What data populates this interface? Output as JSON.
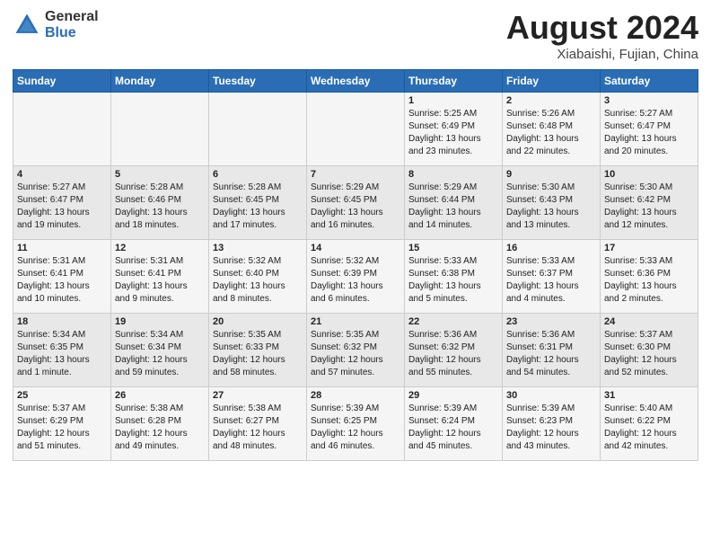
{
  "header": {
    "logo_general": "General",
    "logo_blue": "Blue",
    "title": "August 2024",
    "subtitle": "Xiabaishi, Fujian, China"
  },
  "weekdays": [
    "Sunday",
    "Monday",
    "Tuesday",
    "Wednesday",
    "Thursday",
    "Friday",
    "Saturday"
  ],
  "rows": [
    [
      {
        "day": "",
        "lines": []
      },
      {
        "day": "",
        "lines": []
      },
      {
        "day": "",
        "lines": []
      },
      {
        "day": "",
        "lines": []
      },
      {
        "day": "1",
        "lines": [
          "Sunrise: 5:25 AM",
          "Sunset: 6:49 PM",
          "Daylight: 13 hours",
          "and 23 minutes."
        ]
      },
      {
        "day": "2",
        "lines": [
          "Sunrise: 5:26 AM",
          "Sunset: 6:48 PM",
          "Daylight: 13 hours",
          "and 22 minutes."
        ]
      },
      {
        "day": "3",
        "lines": [
          "Sunrise: 5:27 AM",
          "Sunset: 6:47 PM",
          "Daylight: 13 hours",
          "and 20 minutes."
        ]
      }
    ],
    [
      {
        "day": "4",
        "lines": [
          "Sunrise: 5:27 AM",
          "Sunset: 6:47 PM",
          "Daylight: 13 hours",
          "and 19 minutes."
        ]
      },
      {
        "day": "5",
        "lines": [
          "Sunrise: 5:28 AM",
          "Sunset: 6:46 PM",
          "Daylight: 13 hours",
          "and 18 minutes."
        ]
      },
      {
        "day": "6",
        "lines": [
          "Sunrise: 5:28 AM",
          "Sunset: 6:45 PM",
          "Daylight: 13 hours",
          "and 17 minutes."
        ]
      },
      {
        "day": "7",
        "lines": [
          "Sunrise: 5:29 AM",
          "Sunset: 6:45 PM",
          "Daylight: 13 hours",
          "and 16 minutes."
        ]
      },
      {
        "day": "8",
        "lines": [
          "Sunrise: 5:29 AM",
          "Sunset: 6:44 PM",
          "Daylight: 13 hours",
          "and 14 minutes."
        ]
      },
      {
        "day": "9",
        "lines": [
          "Sunrise: 5:30 AM",
          "Sunset: 6:43 PM",
          "Daylight: 13 hours",
          "and 13 minutes."
        ]
      },
      {
        "day": "10",
        "lines": [
          "Sunrise: 5:30 AM",
          "Sunset: 6:42 PM",
          "Daylight: 13 hours",
          "and 12 minutes."
        ]
      }
    ],
    [
      {
        "day": "11",
        "lines": [
          "Sunrise: 5:31 AM",
          "Sunset: 6:41 PM",
          "Daylight: 13 hours",
          "and 10 minutes."
        ]
      },
      {
        "day": "12",
        "lines": [
          "Sunrise: 5:31 AM",
          "Sunset: 6:41 PM",
          "Daylight: 13 hours",
          "and 9 minutes."
        ]
      },
      {
        "day": "13",
        "lines": [
          "Sunrise: 5:32 AM",
          "Sunset: 6:40 PM",
          "Daylight: 13 hours",
          "and 8 minutes."
        ]
      },
      {
        "day": "14",
        "lines": [
          "Sunrise: 5:32 AM",
          "Sunset: 6:39 PM",
          "Daylight: 13 hours",
          "and 6 minutes."
        ]
      },
      {
        "day": "15",
        "lines": [
          "Sunrise: 5:33 AM",
          "Sunset: 6:38 PM",
          "Daylight: 13 hours",
          "and 5 minutes."
        ]
      },
      {
        "day": "16",
        "lines": [
          "Sunrise: 5:33 AM",
          "Sunset: 6:37 PM",
          "Daylight: 13 hours",
          "and 4 minutes."
        ]
      },
      {
        "day": "17",
        "lines": [
          "Sunrise: 5:33 AM",
          "Sunset: 6:36 PM",
          "Daylight: 13 hours",
          "and 2 minutes."
        ]
      }
    ],
    [
      {
        "day": "18",
        "lines": [
          "Sunrise: 5:34 AM",
          "Sunset: 6:35 PM",
          "Daylight: 13 hours",
          "and 1 minute."
        ]
      },
      {
        "day": "19",
        "lines": [
          "Sunrise: 5:34 AM",
          "Sunset: 6:34 PM",
          "Daylight: 12 hours",
          "and 59 minutes."
        ]
      },
      {
        "day": "20",
        "lines": [
          "Sunrise: 5:35 AM",
          "Sunset: 6:33 PM",
          "Daylight: 12 hours",
          "and 58 minutes."
        ]
      },
      {
        "day": "21",
        "lines": [
          "Sunrise: 5:35 AM",
          "Sunset: 6:32 PM",
          "Daylight: 12 hours",
          "and 57 minutes."
        ]
      },
      {
        "day": "22",
        "lines": [
          "Sunrise: 5:36 AM",
          "Sunset: 6:32 PM",
          "Daylight: 12 hours",
          "and 55 minutes."
        ]
      },
      {
        "day": "23",
        "lines": [
          "Sunrise: 5:36 AM",
          "Sunset: 6:31 PM",
          "Daylight: 12 hours",
          "and 54 minutes."
        ]
      },
      {
        "day": "24",
        "lines": [
          "Sunrise: 5:37 AM",
          "Sunset: 6:30 PM",
          "Daylight: 12 hours",
          "and 52 minutes."
        ]
      }
    ],
    [
      {
        "day": "25",
        "lines": [
          "Sunrise: 5:37 AM",
          "Sunset: 6:29 PM",
          "Daylight: 12 hours",
          "and 51 minutes."
        ]
      },
      {
        "day": "26",
        "lines": [
          "Sunrise: 5:38 AM",
          "Sunset: 6:28 PM",
          "Daylight: 12 hours",
          "and 49 minutes."
        ]
      },
      {
        "day": "27",
        "lines": [
          "Sunrise: 5:38 AM",
          "Sunset: 6:27 PM",
          "Daylight: 12 hours",
          "and 48 minutes."
        ]
      },
      {
        "day": "28",
        "lines": [
          "Sunrise: 5:39 AM",
          "Sunset: 6:25 PM",
          "Daylight: 12 hours",
          "and 46 minutes."
        ]
      },
      {
        "day": "29",
        "lines": [
          "Sunrise: 5:39 AM",
          "Sunset: 6:24 PM",
          "Daylight: 12 hours",
          "and 45 minutes."
        ]
      },
      {
        "day": "30",
        "lines": [
          "Sunrise: 5:39 AM",
          "Sunset: 6:23 PM",
          "Daylight: 12 hours",
          "and 43 minutes."
        ]
      },
      {
        "day": "31",
        "lines": [
          "Sunrise: 5:40 AM",
          "Sunset: 6:22 PM",
          "Daylight: 12 hours",
          "and 42 minutes."
        ]
      }
    ]
  ]
}
